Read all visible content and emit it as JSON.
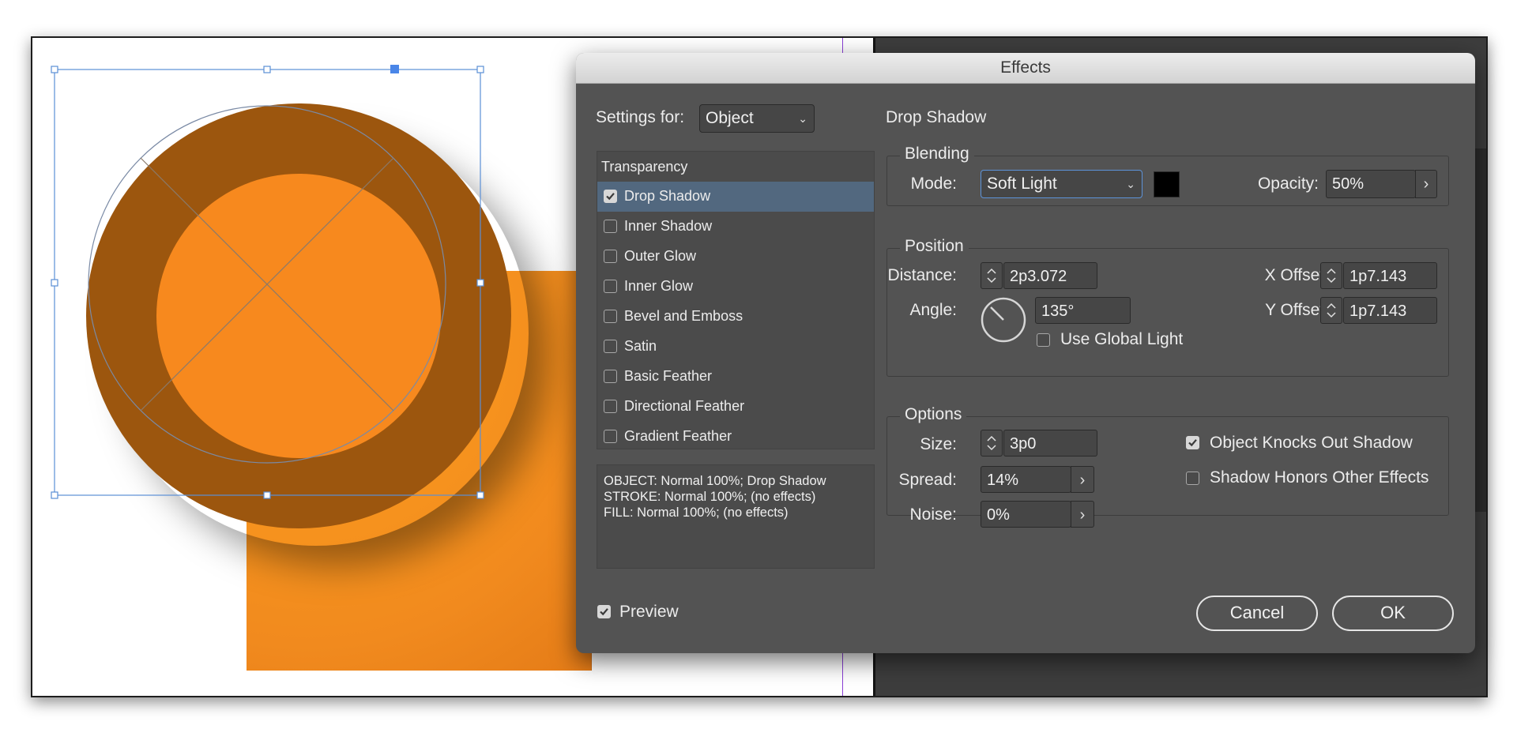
{
  "dialog": {
    "title": "Effects",
    "settings_for": {
      "label": "Settings for:",
      "value": "Object"
    },
    "effects_list": {
      "header": "Transparency",
      "items": [
        {
          "label": "Drop Shadow",
          "checked": true,
          "selected": true
        },
        {
          "label": "Inner Shadow",
          "checked": false,
          "selected": false
        },
        {
          "label": "Outer Glow",
          "checked": false,
          "selected": false
        },
        {
          "label": "Inner Glow",
          "checked": false,
          "selected": false
        },
        {
          "label": "Bevel and Emboss",
          "checked": false,
          "selected": false
        },
        {
          "label": "Satin",
          "checked": false,
          "selected": false
        },
        {
          "label": "Basic Feather",
          "checked": false,
          "selected": false
        },
        {
          "label": "Directional Feather",
          "checked": false,
          "selected": false
        },
        {
          "label": "Gradient Feather",
          "checked": false,
          "selected": false
        }
      ]
    },
    "summary": [
      "OBJECT: Normal 100%; Drop Shadow",
      "STROKE: Normal 100%; (no effects)",
      "FILL: Normal 100%; (no effects)"
    ],
    "preview": {
      "label": "Preview",
      "checked": true
    },
    "section_title": "Drop Shadow",
    "blending": {
      "title": "Blending",
      "mode_label": "Mode:",
      "mode_value": "Soft Light",
      "swatch_color": "#000000",
      "opacity_label": "Opacity:",
      "opacity_value": "50%"
    },
    "position": {
      "title": "Position",
      "distance_label": "Distance:",
      "distance_value": "2p3.072",
      "angle_label": "Angle:",
      "angle_value": "135°",
      "use_global_light": {
        "label": "Use Global Light",
        "checked": false
      },
      "x_offset_label": "X Offset:",
      "x_offset_value": "1p7.143",
      "y_offset_label": "Y Offset:",
      "y_offset_value": "1p7.143"
    },
    "options": {
      "title": "Options",
      "size_label": "Size:",
      "size_value": "3p0",
      "spread_label": "Spread:",
      "spread_value": "14%",
      "noise_label": "Noise:",
      "noise_value": "0%",
      "knocks_out": {
        "label": "Object Knocks Out Shadow",
        "checked": true
      },
      "honors_effects": {
        "label": "Shadow Honors Other Effects",
        "checked": false
      }
    },
    "buttons": {
      "cancel": "Cancel",
      "ok": "OK"
    }
  },
  "colors": {
    "dialog_bg": "#535353",
    "selection_blue": "#52687f",
    "orange_fill": "#f7891e",
    "brown_ring": "#9c560e",
    "frame_blue": "#5b8fd6",
    "guide_purple": "#8a3fd6"
  }
}
